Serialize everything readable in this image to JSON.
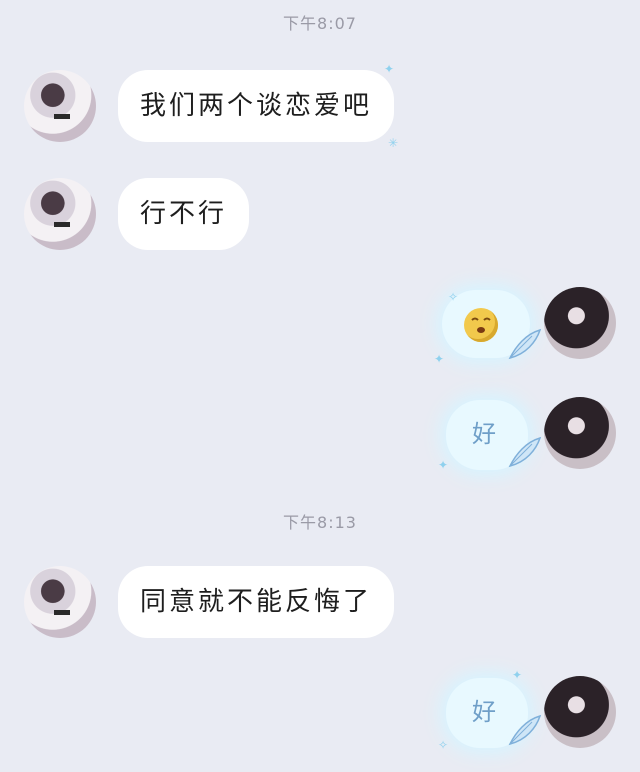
{
  "timestamps": [
    "下午8:07",
    "下午8:13"
  ],
  "messages": [
    {
      "side": "left",
      "text": "我们两个谈恋爱吧"
    },
    {
      "side": "left",
      "text": "行不行"
    },
    {
      "side": "right",
      "type": "emoji",
      "icon": "grimace-emoji-icon"
    },
    {
      "side": "right",
      "text": "好"
    },
    {
      "side": "left",
      "text": "同意就不能反悔了"
    },
    {
      "side": "right",
      "text": "好"
    }
  ],
  "colors": {
    "background": "#e9ebf3",
    "left_bubble": "#ffffff",
    "right_bubble": "#e8f9ff",
    "right_text": "#6f9fc8",
    "timestamp": "#9a9aa6"
  }
}
